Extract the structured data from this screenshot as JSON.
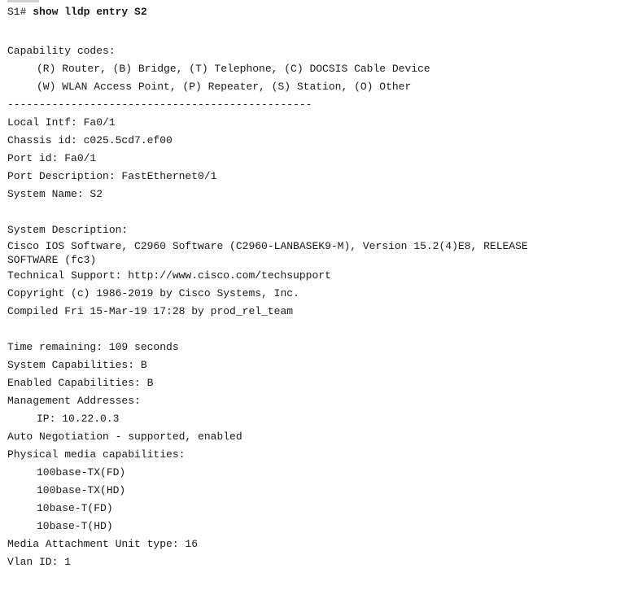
{
  "terminal": {
    "prompt": "S1# ",
    "command": "show lldp entry S2",
    "capability_header": "Capability codes:",
    "codes_line1": "(R) Router, (B) Bridge, (T) Telephone, (C) DOCSIS Cable Device",
    "codes_line2": "(W) WLAN Access Point, (P) Repeater, (S) Station, (O) Other",
    "separator": "------------------------------------------------",
    "local_intf": "Local Intf: Fa0/1",
    "chassis_id": "Chassis id: c025.5cd7.ef00",
    "port_id": "Port id: Fa0/1",
    "port_description": "Port Description: FastEthernet0/1",
    "system_name": "System Name: S2",
    "system_description_label": "System Description:",
    "sysdesc_line1": "Cisco IOS Software, C2960 Software (C2960-LANBASEK9-M), Version 15.2(4)E8, RELEASE",
    "sysdesc_line2": "SOFTWARE (fc3)",
    "tech_support": "Technical Support: http://www.cisco.com/techsupport",
    "copyright": "Copyright (c) 1986-2019 by Cisco Systems, Inc.",
    "compiled": "Compiled Fri 15-Mar-19 17:28 by prod_rel_team",
    "time_remaining": "Time remaining: 109 seconds",
    "system_capabilities": "System Capabilities: B",
    "enabled_capabilities": "Enabled Capabilities: B",
    "management_addresses": "Management Addresses:",
    "ip": "IP: 10.22.0.3",
    "auto_negotiation": "Auto Negotiation - supported, enabled",
    "physical_media": "Physical media capabilities:",
    "media_caps": [
      "100base-TX(FD)",
      "100base-TX(HD)",
      "10base-T(FD)",
      "10base-T(HD)"
    ],
    "mau_type": "Media Attachment Unit type: 16",
    "vlan_id": "Vlan ID: 1"
  }
}
